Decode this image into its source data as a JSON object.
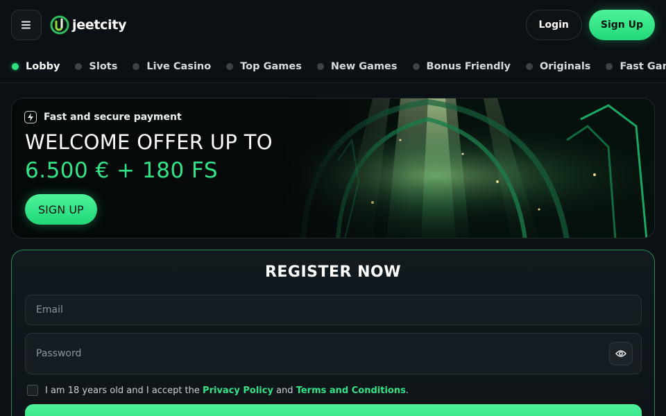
{
  "header": {
    "logo_text": "jeetcity",
    "login_label": "Login",
    "signup_label": "Sign Up"
  },
  "nav": {
    "items": [
      {
        "label": "Lobby",
        "active": true
      },
      {
        "label": "Slots"
      },
      {
        "label": "Live Casino"
      },
      {
        "label": "Top Games"
      },
      {
        "label": "New Games"
      },
      {
        "label": "Bonus Friendly"
      },
      {
        "label": "Originals"
      },
      {
        "label": "Fast Games"
      }
    ]
  },
  "banner": {
    "tag": "Fast and secure payment",
    "title": "WELCOME OFFER UP TO",
    "amount": "6.500 € + 180 FS",
    "cta": "SIGN UP"
  },
  "register": {
    "title": "REGISTER NOW",
    "email_placeholder": "Email",
    "password_placeholder": "Password",
    "terms_prefix": "I am 18 years old and I accept the",
    "privacy_link": "Privacy Policy",
    "terms_and": "and",
    "terms_link": "Terms and Conditions",
    "terms_suffix": "."
  },
  "colors": {
    "accent": "#33e487",
    "background": "#0b1014"
  }
}
